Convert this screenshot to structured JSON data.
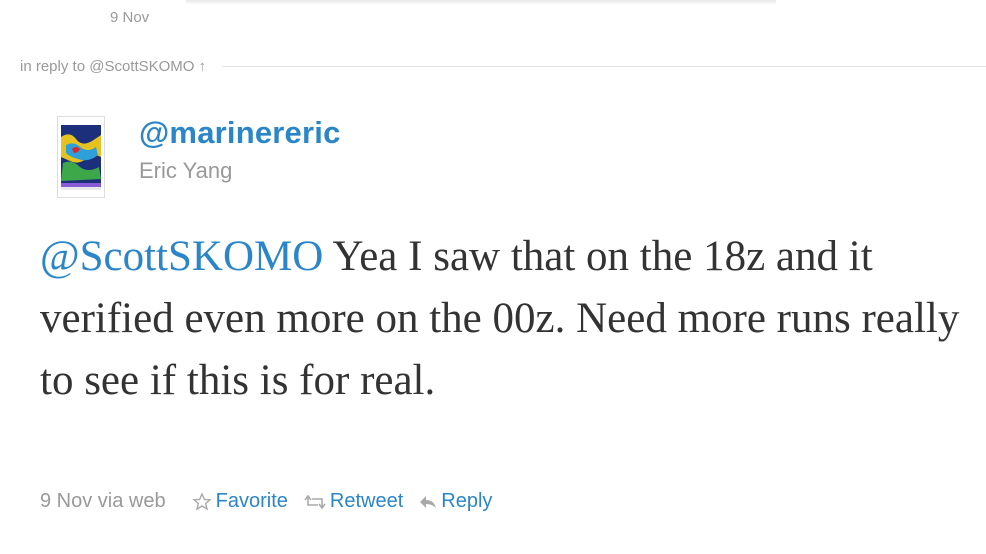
{
  "previous_tweet": {
    "date": "9 Nov"
  },
  "reply_context": {
    "prefix": "in reply to",
    "user": "@ScottSKOMO",
    "arrow": "↑"
  },
  "author": {
    "screen_name": "@marinereric",
    "full_name": "Eric Yang",
    "avatar_icon": "weather-map-avatar"
  },
  "tweet": {
    "mention": "@ScottSKOMO",
    "text": " Yea I saw that on the 18z and it verified even more on the 00z. Need more runs really to see if this is for real."
  },
  "footer": {
    "meta": "9 Nov via web",
    "actions": [
      {
        "label": "Favorite",
        "icon": "star-icon"
      },
      {
        "label": "Retweet",
        "icon": "retweet-icon"
      },
      {
        "label": "Reply",
        "icon": "reply-icon"
      }
    ]
  },
  "colors": {
    "link": "#2a86c8",
    "muted": "#999999",
    "text": "#333333"
  }
}
